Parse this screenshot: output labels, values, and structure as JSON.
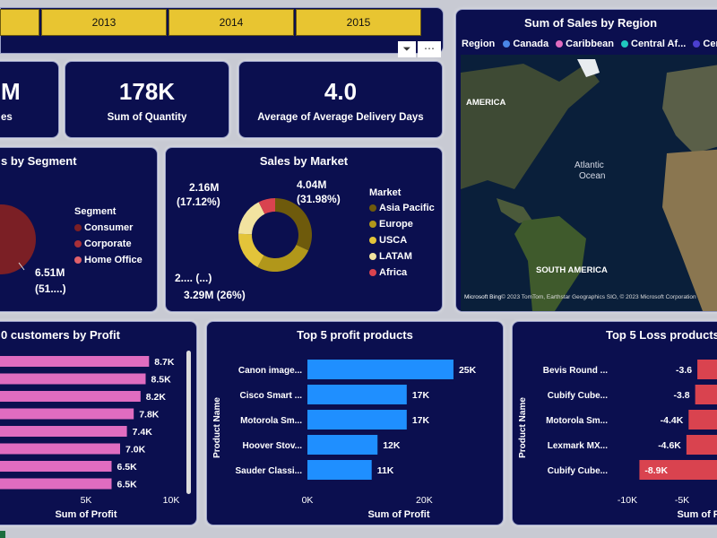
{
  "slicer": {
    "years": [
      "2013",
      "2014",
      "2015"
    ]
  },
  "kpis": [
    {
      "value": "M",
      "label": "es"
    },
    {
      "value": "178K",
      "label": "Sum of Quantity"
    },
    {
      "value": "4.0",
      "label": "Average of Average Delivery Days"
    }
  ],
  "colors": {
    "bg": "#0b0f4f",
    "pink": "#e06cc0",
    "blue": "#1f8fff",
    "red": "#d9434f"
  },
  "chart_data": [
    {
      "type": "pie",
      "title": "s by Segment",
      "legend_title": "Segment",
      "legend": [
        {
          "name": "Consumer",
          "color": "#7b1f25"
        },
        {
          "name": "Corporate",
          "color": "#a93038"
        },
        {
          "name": "Home Office",
          "color": "#e0606a"
        }
      ],
      "data_label": "6.51M",
      "data_label_pct": "(51....)"
    },
    {
      "type": "pie",
      "title": "Sales by Market",
      "legend_title": "Market",
      "categories": [
        "Asia Pacific",
        "Europe",
        "USCA",
        "LATAM",
        "Africa"
      ],
      "values_pct": [
        31.98,
        26,
        17.5,
        17.12,
        7.4
      ],
      "colors": [
        "#6e5a0c",
        "#b1971a",
        "#e3c43a",
        "#f2e3a0",
        "#d9434f"
      ],
      "labels": [
        "4.04M",
        "(31.98%)",
        "2.16M",
        "(17.12%)",
        "3.29M (26%)",
        "2.... (...)"
      ]
    },
    {
      "type": "bar",
      "title": "0 customers by Profit",
      "xlabel": "Sum of Profit",
      "values": [
        8700,
        8500,
        8200,
        7800,
        7400,
        7000,
        6500,
        6500
      ],
      "data_labels": [
        "8.7K",
        "8.5K",
        "8.2K",
        "7.8K",
        "7.4K",
        "7.0K",
        "6.5K",
        "6.5K"
      ],
      "xticks": [
        "5K",
        "10K"
      ],
      "xlim": [
        0,
        10000
      ]
    },
    {
      "type": "bar",
      "title": "Top 5 profit products",
      "xlabel": "Sum of Profit",
      "ylabel": "Product Name",
      "categories": [
        "Canon image...",
        "Cisco Smart ...",
        "Motorola Sm...",
        "Hoover Stov...",
        "Sauder Classi..."
      ],
      "values": [
        25000,
        17000,
        17000,
        12000,
        11000
      ],
      "data_labels": [
        "25K",
        "17K",
        "17K",
        "12K",
        "11K"
      ],
      "xticks": [
        "0K",
        "20K"
      ],
      "xlim": [
        0,
        27000
      ]
    },
    {
      "type": "bar",
      "title": "Top 5 Loss products",
      "xlabel": "Sum of Profit",
      "ylabel": "Product Name",
      "categories": [
        "Bevis Round ...",
        "Cubify Cube...",
        "Motorola Sm...",
        "Lexmark MX...",
        "Cubify Cube..."
      ],
      "values": [
        -3600,
        -3800,
        -4400,
        -4600,
        -8900
      ],
      "data_labels": [
        "-3.6",
        "-3.8",
        "-4.4K",
        "-4.6K",
        "-8.9K"
      ],
      "xticks": [
        "-10K",
        "-5K"
      ]
    }
  ],
  "map": {
    "title": "Sum of Sales by Region",
    "legend_title": "Region",
    "legend": [
      {
        "name": "Canada",
        "color": "#4a86e8"
      },
      {
        "name": "Caribbean",
        "color": "#e06cc0"
      },
      {
        "name": "Central Af...",
        "color": "#20c8c0"
      },
      {
        "name": "Central",
        "color": "#4b3fd0"
      }
    ],
    "labels": {
      "america": "AMERICA",
      "ocean1": "Atlantic",
      "ocean2": "Ocean",
      "south_america": "SOUTH AMERICA"
    },
    "attribution": "© 2023 TomTom, Earthstar Geographics SIO, © 2023 Microsoft Corporation",
    "bing": "Microsoft Bing"
  }
}
